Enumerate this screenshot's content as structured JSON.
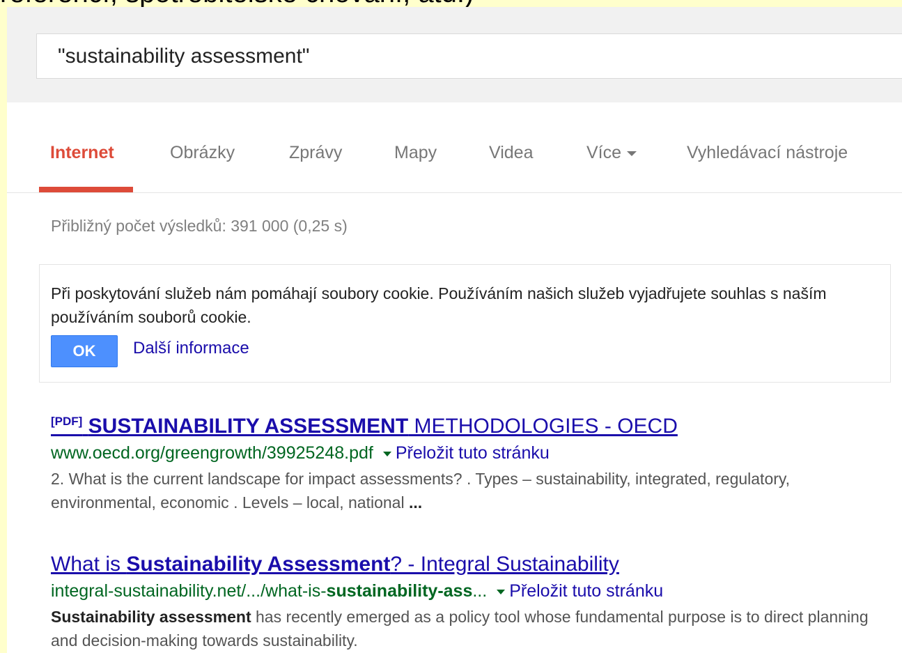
{
  "slide_text": "referencí, spotřebitelské chování, atd.)",
  "search": {
    "query": "\"sustainability assessment\""
  },
  "tabs": [
    {
      "label": "Internet",
      "active": true
    },
    {
      "label": "Obrázky"
    },
    {
      "label": "Zprávy"
    },
    {
      "label": "Mapy"
    },
    {
      "label": "Videa"
    },
    {
      "label": "Více"
    },
    {
      "label": "Vyhledávací nástroje"
    }
  ],
  "result_stats": "Přibližný počet výsledků: 391 000 (0,25 s)",
  "cookie": {
    "text": "Při poskytování služeb nám pomáhají soubory cookie. Používáním našich služeb vyjadřujete souhlas s naším používáním souborů cookie.",
    "ok_label": "OK",
    "more_label": "Další informace"
  },
  "results": [
    {
      "tag": "[PDF]",
      "title_bold": "SUSTAINABILITY ASSESSMENT",
      "title_rest": " METHODOLOGIES - OECD",
      "url": "www.oecd.org/greengrowth/39925248.pdf",
      "translate": "Přeložit tuto stránku",
      "snippet": "2. What is the current landscape for impact assessments? . Types – sustainability, integrated, regulatory, environmental, economic . Levels – local, national ",
      "snippet_end": "..."
    },
    {
      "title_a": "What is ",
      "title_bold": "Sustainability Assessment",
      "title_b": "? - Integral Sustainability",
      "url_a": "integral-sustainability.net/.../what-is-",
      "url_bold": "sustainability-ass",
      "url_b": "...",
      "translate": "Přeložit tuto stránku",
      "snippet_bold": "Sustainability assessment",
      "snippet": " has recently emerged as a policy tool whose fundamental purpose is to direct planning and decision-making towards sustainability."
    }
  ],
  "colors": {
    "accent": "#dd4b39",
    "link": "#1a0dab",
    "url": "#006621",
    "button": "#4d90fe",
    "slide_bg": "#ffffcc"
  }
}
